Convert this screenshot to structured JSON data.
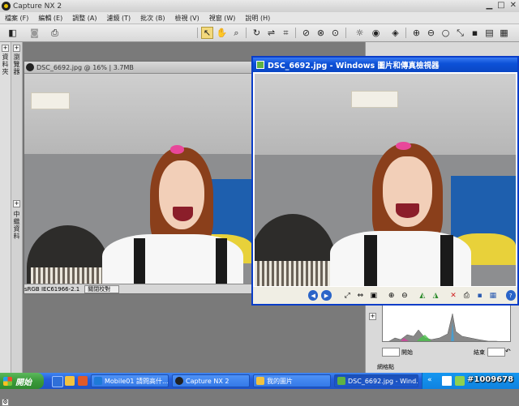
{
  "app": {
    "title": "Capture NX 2"
  },
  "menu": [
    "檔案 (F)",
    "編輯 (E)",
    "調整 (A)",
    "濾鏡 (T)",
    "批次 (B)",
    "檢視 (V)",
    "視窗 (W)",
    "說明 (H)"
  ],
  "left_strip": {
    "tab1": "資料夾",
    "tab2": "瀏覽器",
    "tab3": "中繼資料"
  },
  "nx_window": {
    "title": "DSC_6692.jpg @ 16% | 3.7MB",
    "status_profile": "sRGB IEC61966-2.1",
    "status_mode": "關閉校對"
  },
  "viewer": {
    "title": "DSC_6692.jpg - Windows 圖片和傳真檢視器"
  },
  "histogram": {
    "start_label": "開始",
    "end_label": "結束",
    "panel_label": "網格點"
  },
  "taskbar": {
    "start": "開始",
    "tasks": [
      "Mobile01 請問高什...",
      "Capture NX 2",
      "我的圖片",
      "DSC_6692.jpg - Wind..."
    ],
    "watermark": "#1009678"
  },
  "colors": {
    "xp_blue": "#245edb",
    "viewer_title": "#0d52d8",
    "start_green": "#3b9a3b"
  }
}
